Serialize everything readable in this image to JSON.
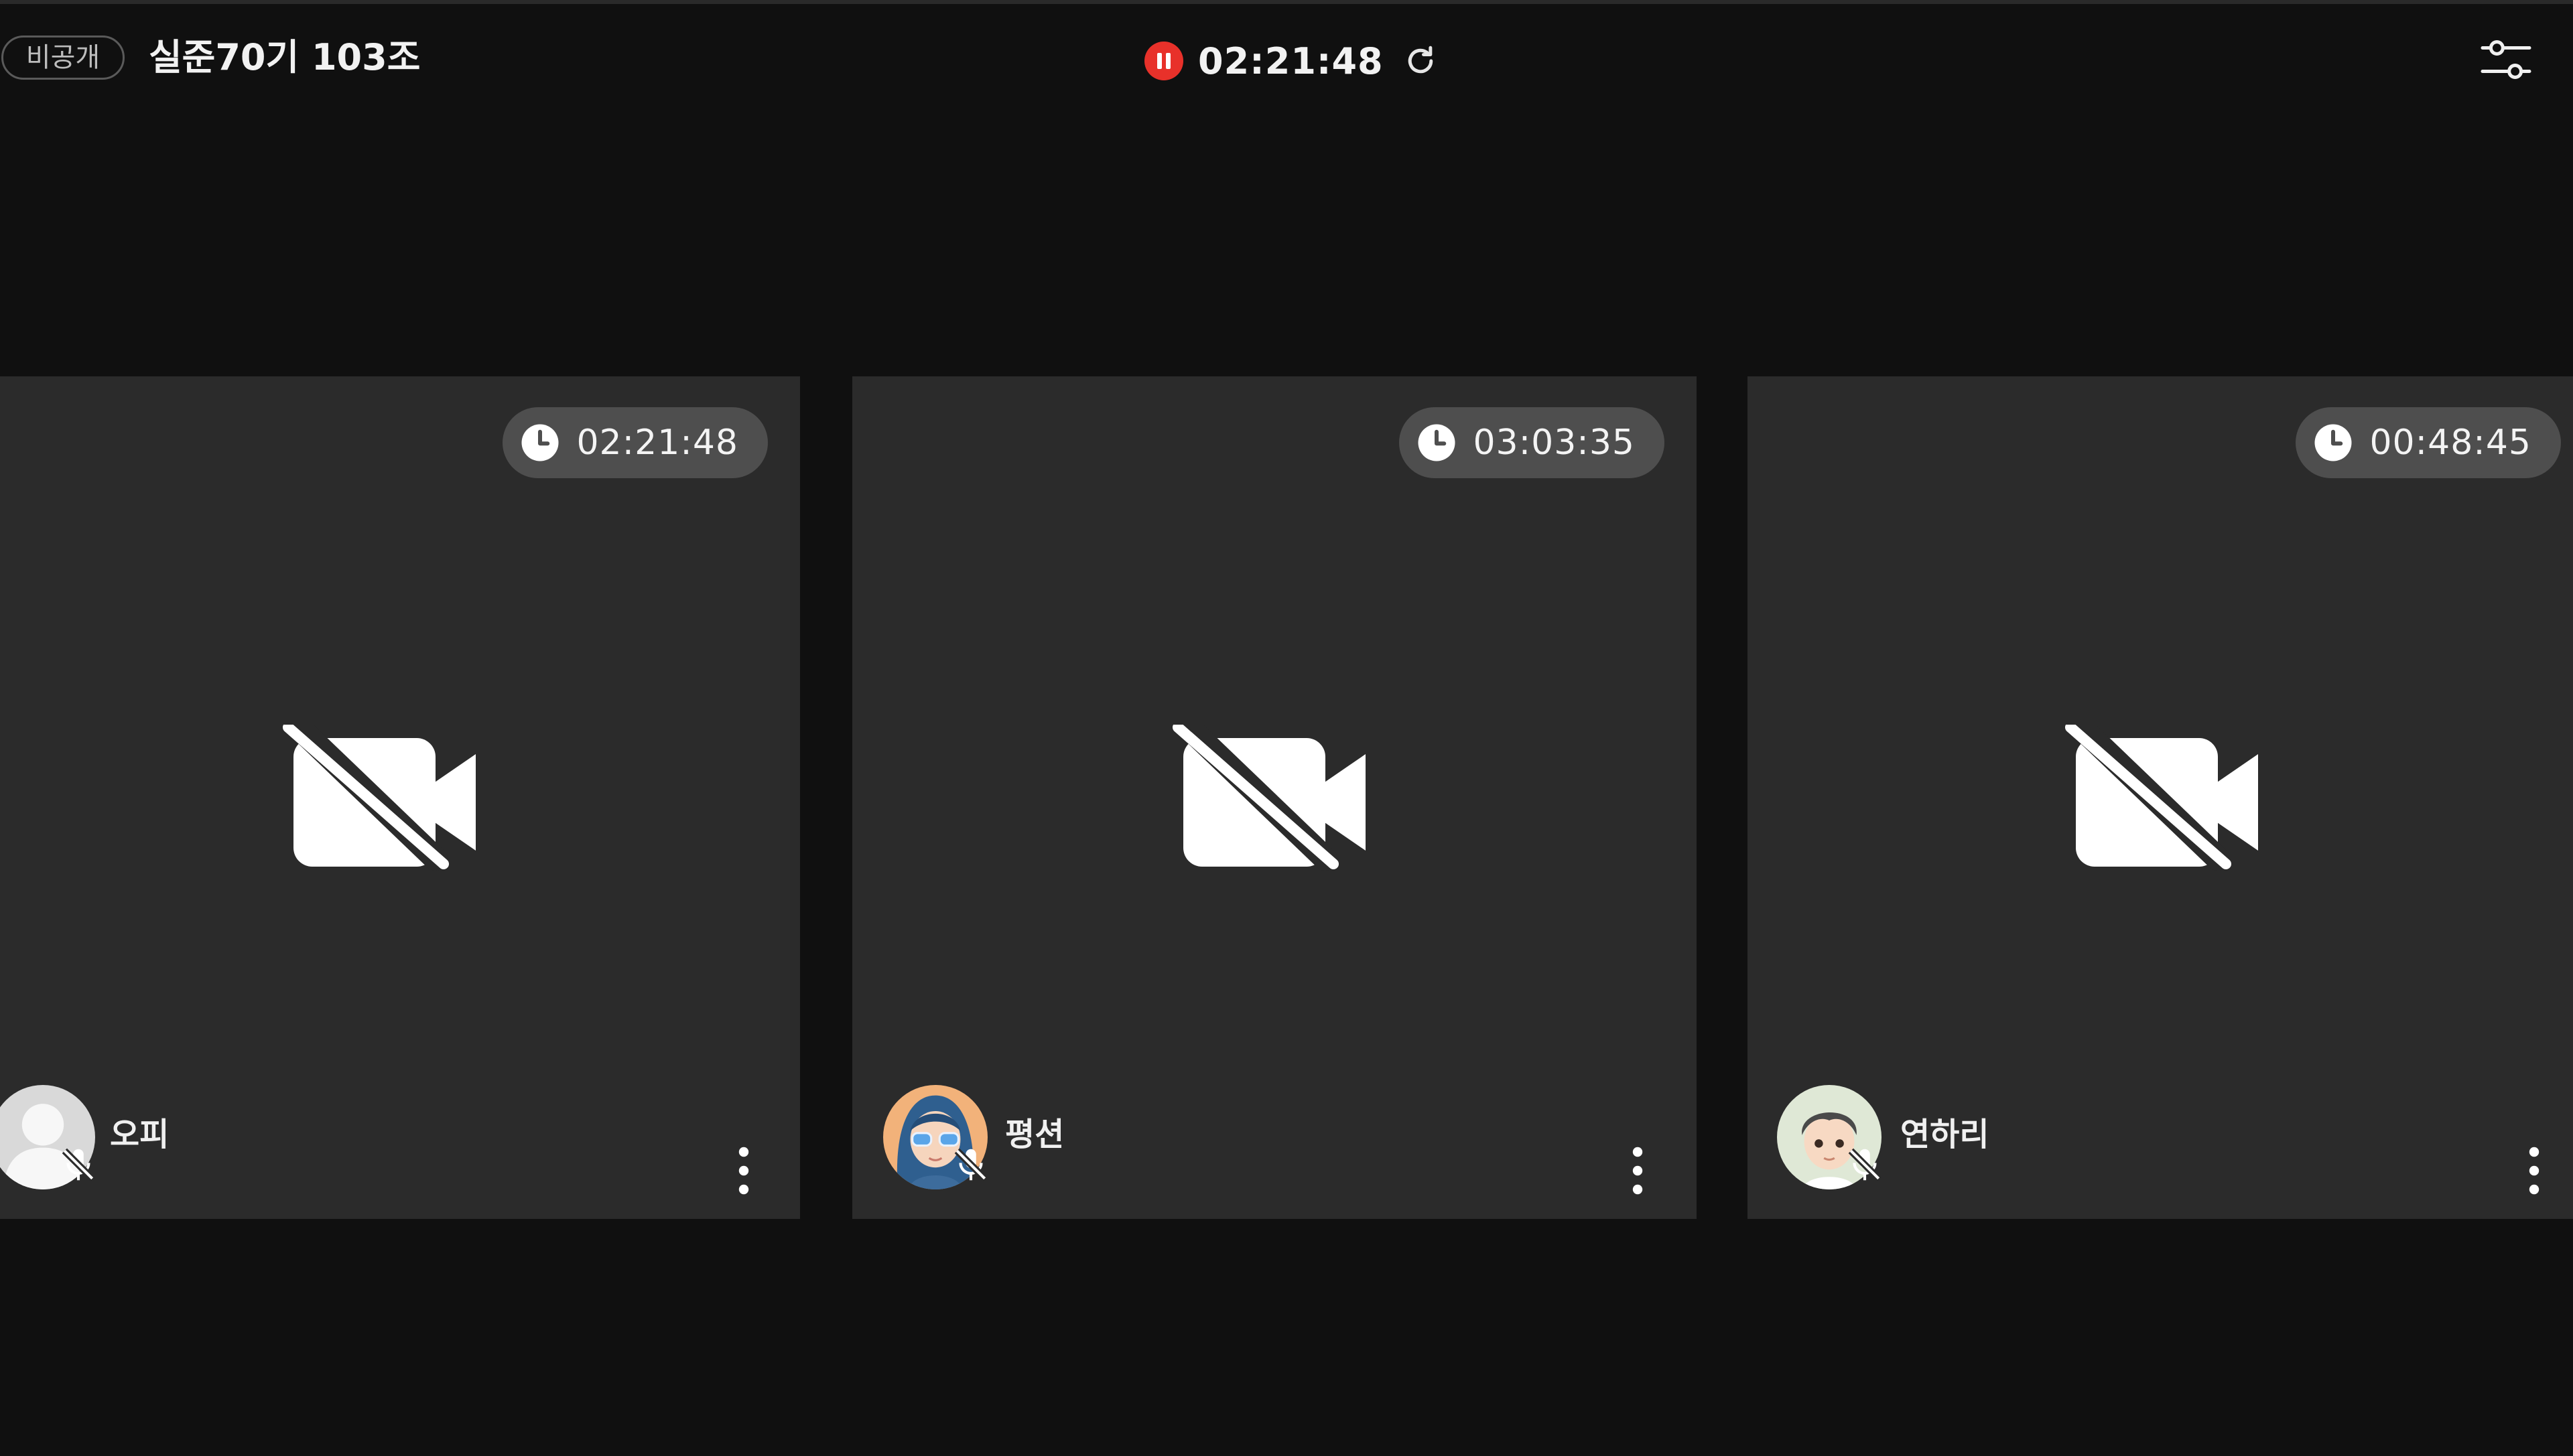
{
  "header": {
    "privacy_badge": "비공개",
    "room_title": "실준70기 103조",
    "recording_time": "02:21:48",
    "recording_icon": "pause-icon",
    "refresh_icon": "refresh-icon",
    "settings_icon": "sliders-icon"
  },
  "colors": {
    "background": "#101010",
    "tile": "#2b2b2b",
    "timer_pill": "#4e4e4e",
    "record": "#e8312a"
  },
  "participants": [
    {
      "name": "오피",
      "timer": "02:21:48",
      "avatar": "default-user-avatar",
      "camera": "off",
      "mic": "off"
    },
    {
      "name": "평션",
      "timer": "03:03:35",
      "avatar": "girl-sunglasses-avatar",
      "camera": "off",
      "mic": "off"
    },
    {
      "name": "연하리",
      "timer": "00:48:45",
      "avatar": "boy-avatar",
      "camera": "off",
      "mic": "off"
    }
  ]
}
